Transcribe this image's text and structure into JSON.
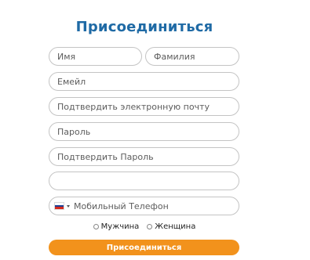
{
  "form": {
    "title": "Присоединиться",
    "first_name": {
      "placeholder": "Имя",
      "value": ""
    },
    "last_name": {
      "placeholder": "Фамилия",
      "value": ""
    },
    "email": {
      "placeholder": "Емейл",
      "value": ""
    },
    "confirm_email": {
      "placeholder": "Подтвердить электронную почту",
      "value": ""
    },
    "password": {
      "placeholder": "Пароль",
      "value": ""
    },
    "confirm_password": {
      "placeholder": "Подтвердить Пароль",
      "value": ""
    },
    "extra_field": {
      "placeholder": "",
      "value": ""
    },
    "phone": {
      "placeholder": "Мобильный Телефон",
      "value": "",
      "country_flag": "russia-flag-icon",
      "flag_colors": [
        "#ffffff",
        "#1c3f94",
        "#d52b1e"
      ]
    },
    "gender": {
      "male_label": "Мужчина",
      "female_label": "Женщина"
    },
    "submit_label": "Присоединиться"
  },
  "colors": {
    "title": "#1f6aa5",
    "submit_bg": "#f2921c",
    "field_border": "#c4c4c4"
  }
}
